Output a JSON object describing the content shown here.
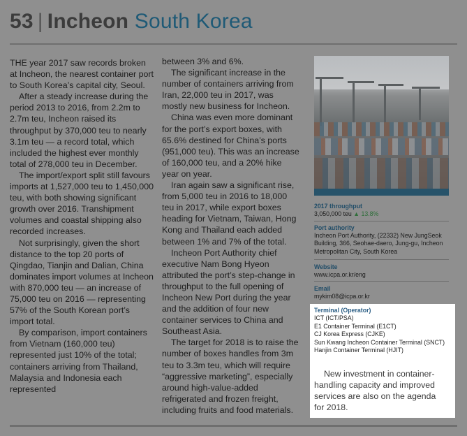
{
  "header": {
    "number": "53",
    "separator": "|",
    "city": "Incheon",
    "country": "South Korea"
  },
  "column1": [
    "THE year 2017 saw records broken at Incheon, the nearest container port to South Korea’s capital city, Seoul.",
    "After a steady increase during the period 2013 to 2016, from 2.2m to 2.7m teu, Incheon raised its throughput by 370,000 teu to nearly 3.1m teu — a record total, which included the highest ever monthly total of 278,000 teu in December.",
    "The import/export split still favours imports at 1,527,000 teu to 1,450,000 teu, with both showing significant growth over 2016. Transhipment volumes and coastal shipping also recorded increases.",
    "Not surprisingly, given the short distance to the top 20 ports of Qingdao, Tianjin and Dalian, China dominates import volumes at Incheon with 870,000 teu — an increase of 75,000 teu on 2016 — representing 57% of the South Korean port’s import total.",
    "By comparison, import containers from Vietnam (160,000 teu) represented just 10% of the total; containers arriving from Thailand, Malaysia and Indonesia each represented"
  ],
  "column2": [
    "between 3% and 6%.",
    "The significant increase in the number of containers arriving from Iran, 22,000 teu in 2017, was mostly new business for Incheon.",
    "China was even more dominant for the port’s export boxes, with 65.6% destined for China’s ports (951,000 teu). This was an increase of 160,000 teu, and a 20% hike year on year.",
    "Iran again saw a significant rise, from 5,000 teu in 2016 to 18,000 teu in 2017, while export boxes heading for Vietnam, Taiwan, Hong Kong and Thailand each added between 1% and 7% of the total.",
    "Incheon Port Authority chief executive Nam Bong Hyeon attributed the port’s step-change in throughput to the full opening of Incheon New Port during the year and the addition of four new container services to China and Southeast Asia.",
    "The target for 2018 is to raise the number of boxes handles from 3m teu to 3.3m teu, which will require “aggressive marketing”, especially around high-value-added refrigerated and frozen freight, including fruits and food materials."
  ],
  "sidebar": {
    "throughput_label": "2017 throughput",
    "throughput_value": "3,050,000 teu",
    "throughput_change": "13.8%",
    "authority_label": "Port authority",
    "authority_value": "Incheon Port Authority, (22332) New JungSeok Building, 366, Seohae-daero, Jung-gu, Incheon Metropolitan City, South Korea",
    "website_label": "Website",
    "website_value": "www.icpa.or.kr/eng",
    "email_label": "Email",
    "email_value": "mykim08@icpa.or.kr"
  },
  "terminals": {
    "label": "Terminal (Operator)",
    "items": [
      "ICT (ICT/PSA)",
      "E1 Container Terminal (E1CT)",
      "CJ Korea Express (CJKE)",
      "Sun Kwang Incheon Container Terminal (SNCT)",
      "Hanjin Container Terminal (HJIT)"
    ],
    "note": "New investment in container-handling capacity and improved services are also on the agenda for 2018."
  },
  "colors": {
    "accent": "#1f5a76",
    "bar": "#27536a",
    "up_arrow": "#2f6e3a"
  }
}
